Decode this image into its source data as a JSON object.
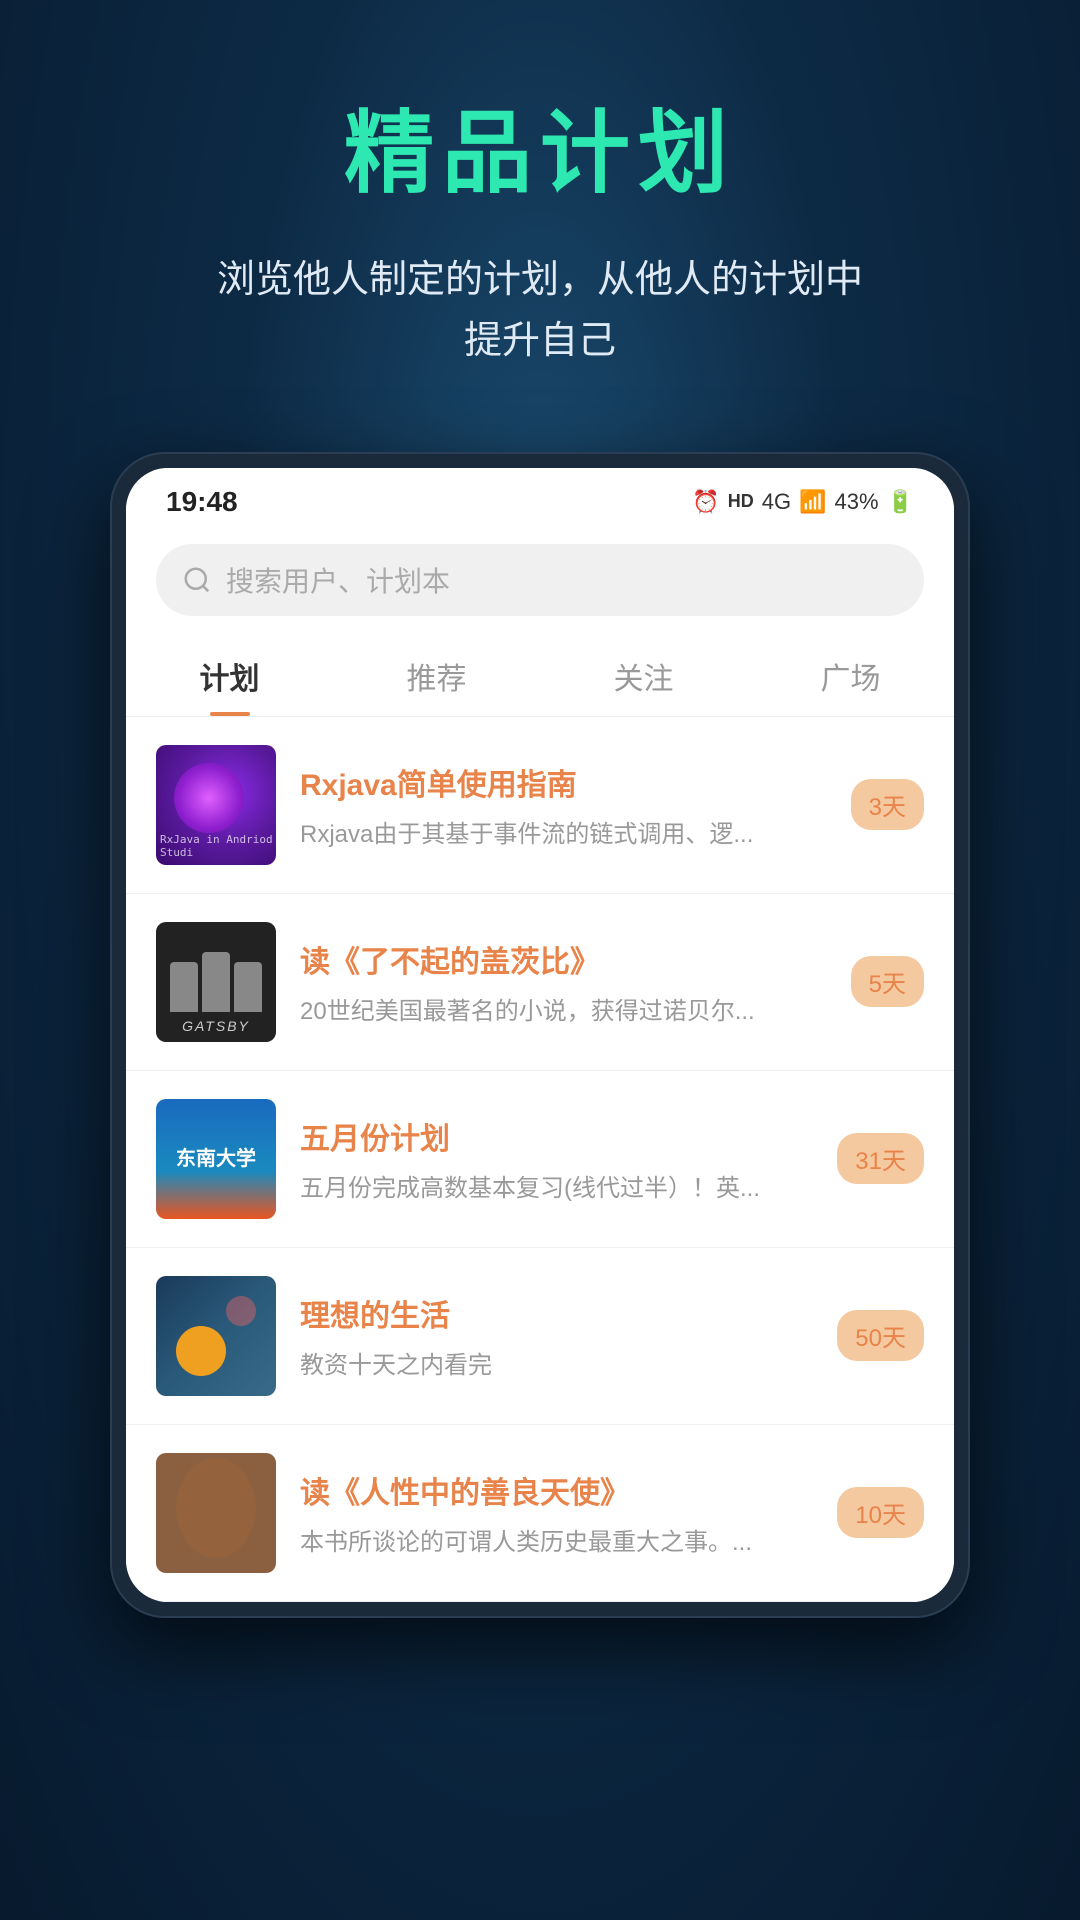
{
  "header": {
    "title": "精品计划",
    "subtitle_line1": "浏览他人制定的计划，从他人的计划中",
    "subtitle_line2": "提升自己"
  },
  "status_bar": {
    "time": "19:48",
    "battery": "43%",
    "signal": "4G"
  },
  "search": {
    "placeholder": "搜索用户、计划本"
  },
  "tabs": [
    {
      "label": "计划",
      "active": true
    },
    {
      "label": "推荐",
      "active": false
    },
    {
      "label": "关注",
      "active": false
    },
    {
      "label": "广场",
      "active": false
    }
  ],
  "list_items": [
    {
      "id": 1,
      "title": "Rxjava简单使用指南",
      "description": "Rxjava由于其基于事件流的链式调用、逻...",
      "badge": "3天",
      "thumb_type": "rxjava"
    },
    {
      "id": 2,
      "title": "读《了不起的盖茨比》",
      "description": "20世纪美国最著名的小说，获得过诺贝尔...",
      "badge": "5天",
      "thumb_type": "gatsby"
    },
    {
      "id": 3,
      "title": "五月份计划",
      "description": "五月份完成高数基本复习(线代过半）！英...",
      "badge": "31天",
      "thumb_type": "dongnan"
    },
    {
      "id": 4,
      "title": "理想的生活",
      "description": "教资十天之内看完",
      "badge": "50天",
      "thumb_type": "ideal"
    },
    {
      "id": 5,
      "title": "读《人性中的善良天使》",
      "description": "本书所谈论的可谓人类历史最重大之事。...",
      "badge": "10天",
      "thumb_type": "angel"
    }
  ]
}
